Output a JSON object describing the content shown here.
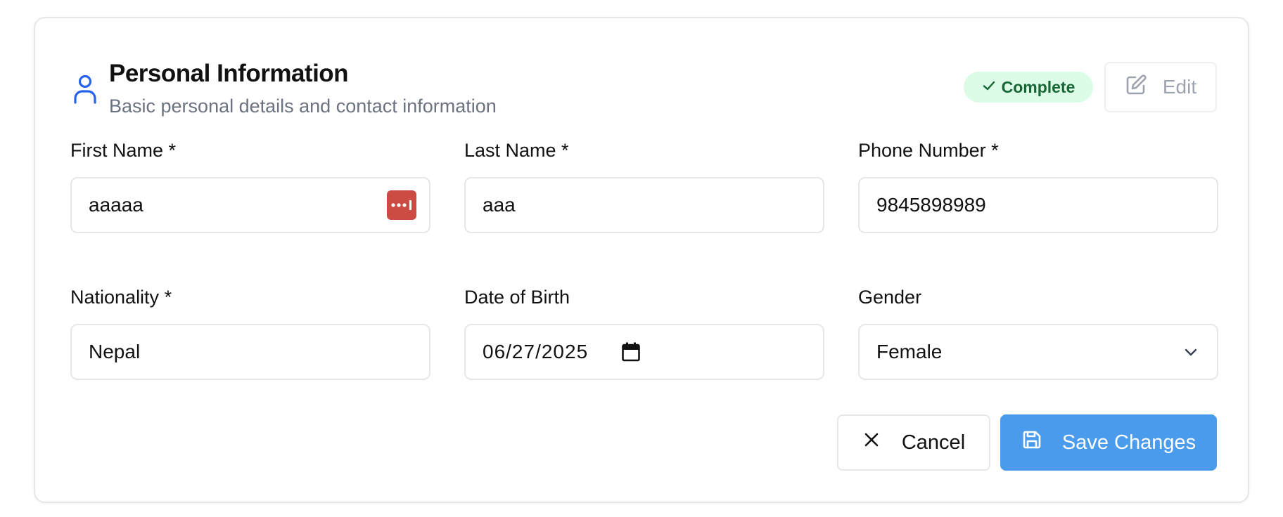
{
  "section": {
    "title": "Personal Information",
    "subtitle": "Basic personal details and contact information",
    "status_badge": "Complete",
    "edit_label": "Edit"
  },
  "fields": {
    "first_name": {
      "label": "First Name *",
      "value": "aaaaa"
    },
    "last_name": {
      "label": "Last Name *",
      "value": "aaa"
    },
    "phone": {
      "label": "Phone Number *",
      "value": "9845898989"
    },
    "nationality": {
      "label": "Nationality *",
      "value": "Nepal"
    },
    "dob": {
      "label": "Date of Birth",
      "value": "06/27/2025"
    },
    "gender": {
      "label": "Gender",
      "value": "Female"
    }
  },
  "actions": {
    "cancel_label": "Cancel",
    "save_label": "Save Changes"
  },
  "colors": {
    "accent": "#4b9bec",
    "icon_blue": "#2563eb",
    "badge_bg": "#dcfce7",
    "badge_text": "#166534",
    "password_manager": "#cc4b42"
  },
  "icons": {
    "section": "user-icon",
    "badge": "check-icon",
    "edit": "pencil-square-icon",
    "first_name_autofill": "password-manager-icon",
    "dob": "calendar-icon",
    "gender": "chevron-down-icon",
    "cancel": "close-icon",
    "save": "save-icon"
  }
}
